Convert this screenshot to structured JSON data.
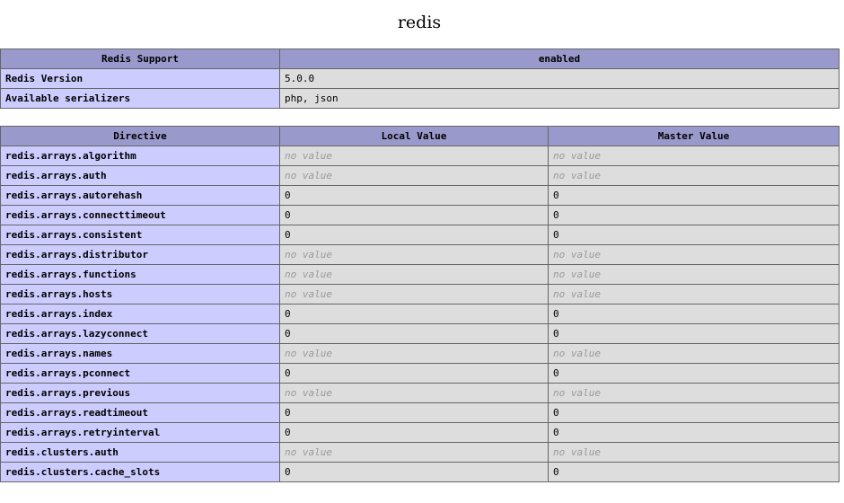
{
  "title": "redis",
  "info": {
    "header": [
      "Redis Support",
      "enabled"
    ],
    "rows": [
      {
        "name": "Redis Version",
        "value": "5.0.0"
      },
      {
        "name": "Available serializers",
        "value": "php, json"
      }
    ]
  },
  "directives": {
    "headers": [
      "Directive",
      "Local Value",
      "Master Value"
    ],
    "no_value_text": "no value",
    "rows": [
      {
        "name": "redis.arrays.algorithm",
        "local": null,
        "master": null
      },
      {
        "name": "redis.arrays.auth",
        "local": null,
        "master": null
      },
      {
        "name": "redis.arrays.autorehash",
        "local": "0",
        "master": "0"
      },
      {
        "name": "redis.arrays.connecttimeout",
        "local": "0",
        "master": "0"
      },
      {
        "name": "redis.arrays.consistent",
        "local": "0",
        "master": "0"
      },
      {
        "name": "redis.arrays.distributor",
        "local": null,
        "master": null
      },
      {
        "name": "redis.arrays.functions",
        "local": null,
        "master": null
      },
      {
        "name": "redis.arrays.hosts",
        "local": null,
        "master": null
      },
      {
        "name": "redis.arrays.index",
        "local": "0",
        "master": "0"
      },
      {
        "name": "redis.arrays.lazyconnect",
        "local": "0",
        "master": "0"
      },
      {
        "name": "redis.arrays.names",
        "local": null,
        "master": null
      },
      {
        "name": "redis.arrays.pconnect",
        "local": "0",
        "master": "0"
      },
      {
        "name": "redis.arrays.previous",
        "local": null,
        "master": null
      },
      {
        "name": "redis.arrays.readtimeout",
        "local": "0",
        "master": "0"
      },
      {
        "name": "redis.arrays.retryinterval",
        "local": "0",
        "master": "0"
      },
      {
        "name": "redis.clusters.auth",
        "local": null,
        "master": null
      },
      {
        "name": "redis.clusters.cache_slots",
        "local": "0",
        "master": "0"
      }
    ]
  }
}
